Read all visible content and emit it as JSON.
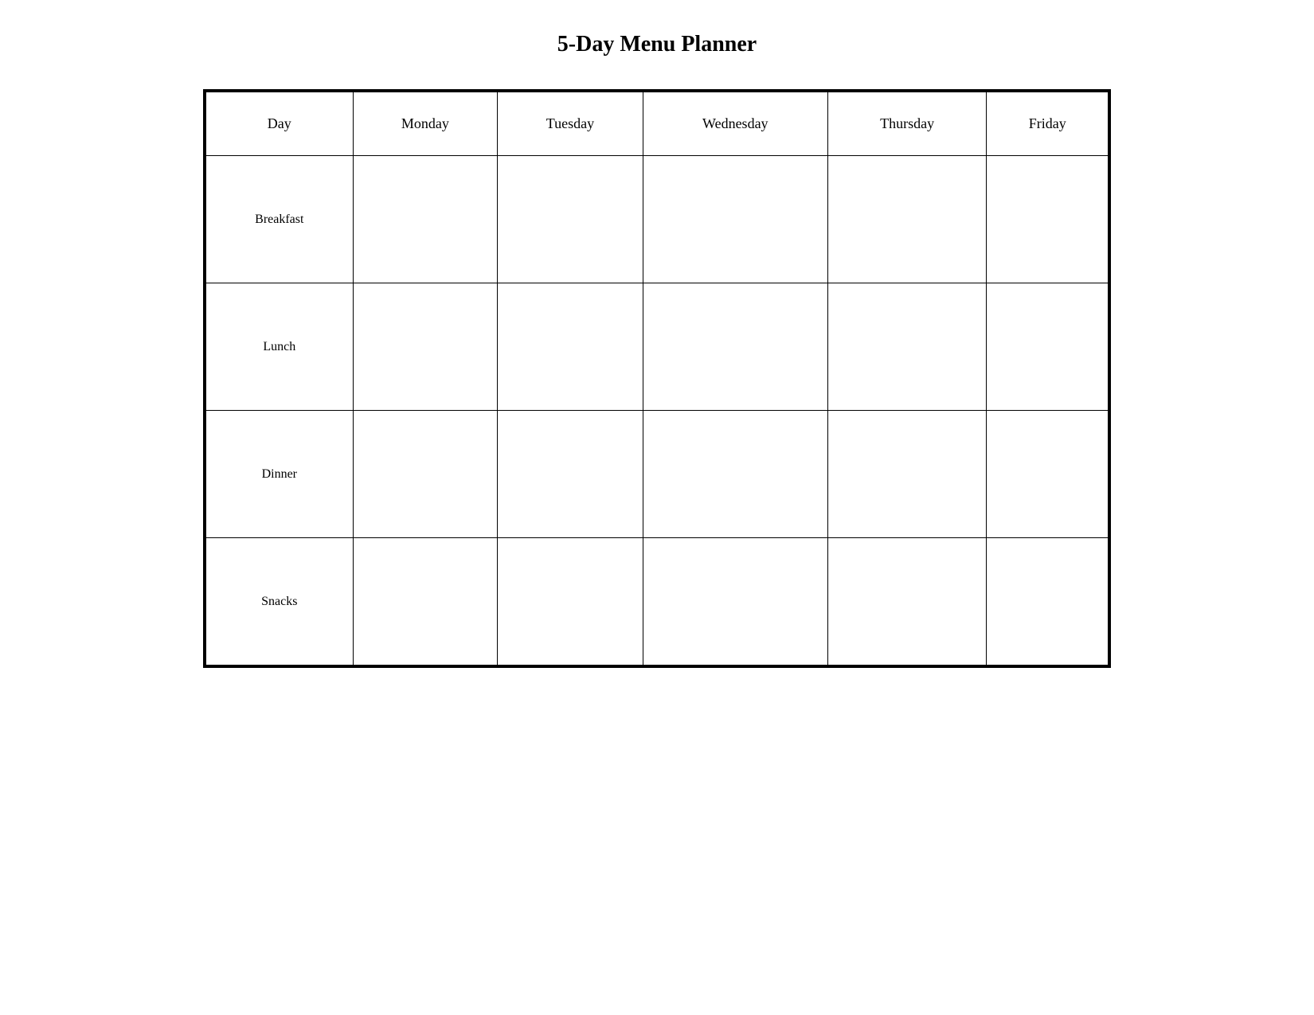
{
  "title": "5-Day Menu Planner",
  "headers": {
    "col0": "Day",
    "col1": "Monday",
    "col2": "Tuesday",
    "col3": "Wednesday",
    "col4": "Thursday",
    "col5": "Friday"
  },
  "meal_rows": [
    {
      "label": "Breakfast"
    },
    {
      "label": "Lunch"
    },
    {
      "label": "Dinner"
    },
    {
      "label": "Snacks"
    }
  ]
}
